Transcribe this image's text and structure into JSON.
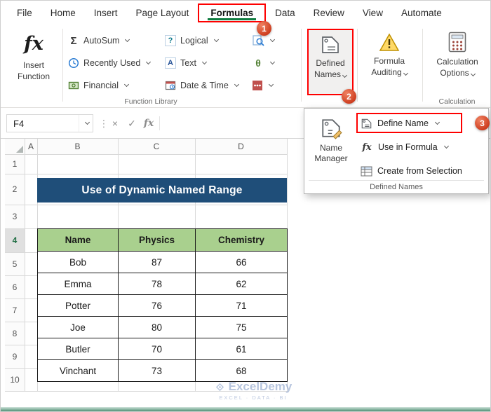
{
  "menubar": {
    "tabs": [
      "File",
      "Home",
      "Insert",
      "Page Layout",
      "Formulas",
      "Data",
      "Review",
      "View",
      "Automate"
    ],
    "active_tab": "Formulas"
  },
  "ribbon": {
    "insert_function_label": "Insert Function",
    "buttons": {
      "autosum": "AutoSum",
      "recently_used": "Recently Used",
      "financial": "Financial",
      "logical": "Logical",
      "text": "Text",
      "date_time": "Date & Time"
    },
    "defined_names_label": "Defined Names",
    "formula_auditing_label": "Formula Auditing",
    "calculation_options_label": "Calculation Options",
    "group_labels": {
      "function_library": "Function Library",
      "calculation": "Calculation"
    }
  },
  "icons": {
    "fx": "fx",
    "sigma": "Σ",
    "theta": "θ",
    "question_mark": "?",
    "letter_a": "A",
    "dots": "⋮",
    "cancel": "×",
    "enter": "✓"
  },
  "formula_bar": {
    "name_box_value": "F4",
    "fx_label": "fx"
  },
  "defined_names_menu": {
    "name_manager_label": "Name Manager",
    "define_name_label": "Define Name",
    "use_in_formula_label": "Use in Formula",
    "create_from_selection_label": "Create from Selection",
    "footer_label": "Defined Names"
  },
  "callouts": {
    "step1": "1",
    "step2": "2",
    "step3": "3"
  },
  "sheet": {
    "active_cell": "F4",
    "column_headers": [
      "A",
      "B",
      "C",
      "D"
    ],
    "row_headers": [
      "1",
      "2",
      "3",
      "4",
      "5",
      "6",
      "7",
      "8",
      "9",
      "10"
    ],
    "banner_title": "Use of Dynamic Named Range",
    "table": {
      "headers": [
        "Name",
        "Physics",
        "Chemistry"
      ],
      "rows": [
        [
          "Bob",
          "87",
          "66"
        ],
        [
          "Emma",
          "78",
          "62"
        ],
        [
          "Potter",
          "76",
          "71"
        ],
        [
          "Joe",
          "80",
          "75"
        ],
        [
          "Butler",
          "70",
          "61"
        ],
        [
          "Vinchant",
          "73",
          "68"
        ]
      ]
    }
  },
  "watermark": {
    "brand": "ExcelDemy",
    "tagline": "EXCEL · DATA · BI"
  },
  "colors": {
    "highlight_red": "#fe0000",
    "callout_red": "#cc3a1c",
    "banner_blue": "#1f4e79",
    "table_header_green": "#a9d08e",
    "excel_green": "#107c41"
  }
}
